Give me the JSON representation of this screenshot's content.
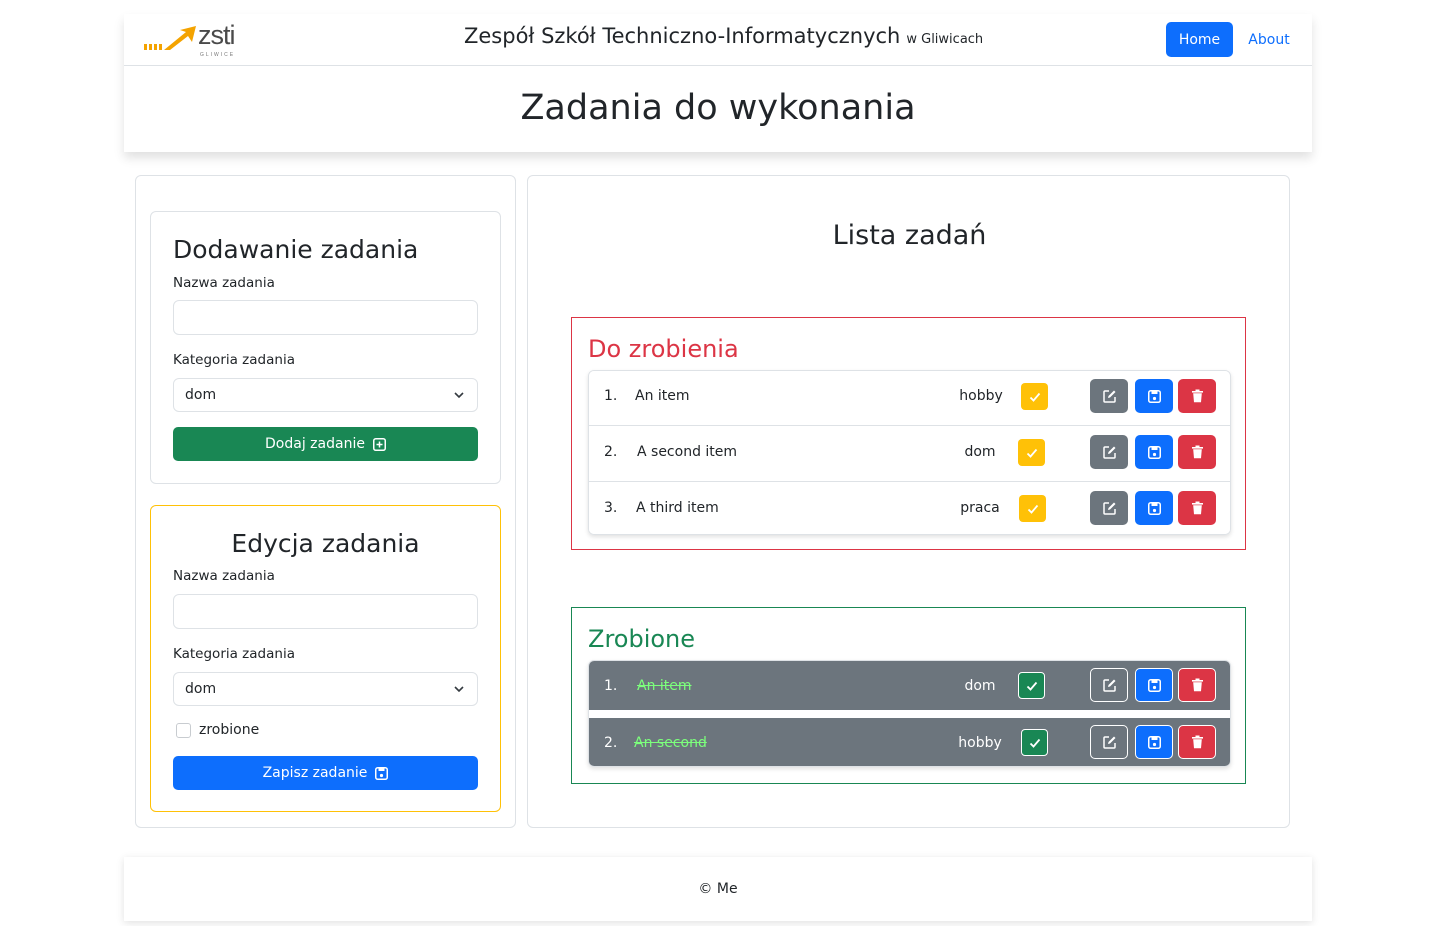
{
  "header": {
    "logo_text": "zsti",
    "logo_sub": "GLIWICE",
    "brand_main": "Zespół Szkół Techniczno-Informatycznych",
    "brand_sub": "w Gliwicach",
    "nav": {
      "home": "Home",
      "about": "About"
    },
    "page_title": "Zadania do wykonania"
  },
  "add_form": {
    "title": "Dodawanie zadania",
    "name_label": "Nazwa zadania",
    "name_value": "",
    "category_label": "Kategoria zadania",
    "category_value": "dom",
    "submit_label": "Dodaj zadanie"
  },
  "edit_form": {
    "title": "Edycja zadania",
    "name_label": "Nazwa zadania",
    "name_value": "",
    "category_label": "Kategoria zadania",
    "category_value": "dom",
    "done_label": "zrobione",
    "submit_label": "Zapisz zadanie"
  },
  "task_list": {
    "title": "Lista zadań",
    "todo": {
      "title": "Do zrobienia",
      "items": [
        {
          "num": "1.",
          "name": "An item",
          "category": "hobby"
        },
        {
          "num": "2.",
          "name": "A second item",
          "category": "dom"
        },
        {
          "num": "3.",
          "name": "A third item",
          "category": "praca"
        }
      ]
    },
    "done": {
      "title": "Zrobione",
      "items": [
        {
          "num": "1.",
          "name": "An item",
          "category": "dom"
        },
        {
          "num": "2.",
          "name": "An second",
          "category": "hobby"
        }
      ]
    }
  },
  "footer": {
    "text": "© Me"
  },
  "colors": {
    "primary": "#0d6efd",
    "success": "#198754",
    "danger": "#dc3545",
    "warning": "#ffc107",
    "secondary": "#6c757d"
  },
  "icons": [
    "logo-arrow-icon",
    "plus-square-icon",
    "save-icon",
    "chevron-down-icon",
    "check-icon",
    "edit-icon",
    "trash-icon"
  ]
}
